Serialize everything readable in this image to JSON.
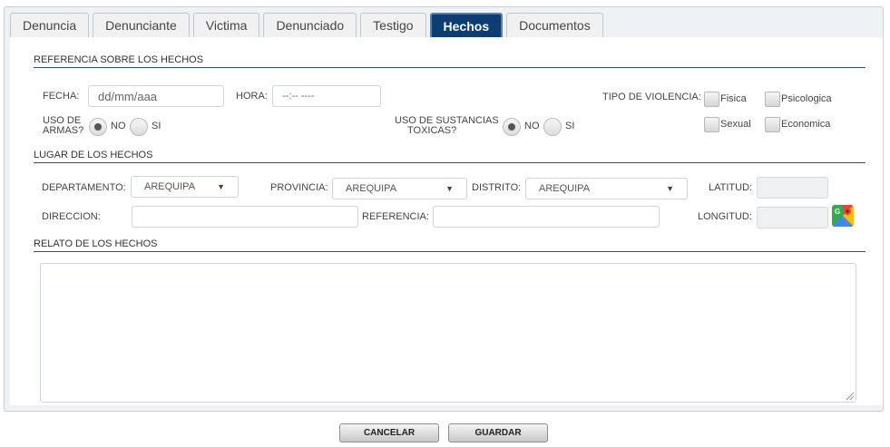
{
  "tabs": [
    {
      "label": "Denuncia"
    },
    {
      "label": "Denunciante"
    },
    {
      "label": "Victima"
    },
    {
      "label": "Denunciado"
    },
    {
      "label": "Testigo"
    },
    {
      "label": "Hechos",
      "active": true
    },
    {
      "label": "Documentos"
    }
  ],
  "referencia": {
    "title": "REFERENCIA SOBRE LOS HECHOS",
    "fecha_label": "FECHA:",
    "fecha_placeholder": "dd/mm/aaa",
    "hora_label": "HORA:",
    "hora_placeholder": "--:--  ----",
    "armas_label_1": "USO DE",
    "armas_label_2": "ARMAS?",
    "sustancias_label_1": "USO DE SUSTANCIAS",
    "sustancias_label_2": "TOXICAS?",
    "no_label": "NO",
    "si_label": "SI",
    "armas_value": "NO",
    "sustancias_value": "NO",
    "tipo_violencia_label": "TIPO DE VIOLENCIA:",
    "violencia_options": {
      "fisica": "Fisica",
      "psicologica": "Psicologica",
      "sexual": "Sexual",
      "economica": "Economica"
    }
  },
  "lugar": {
    "title": "LUGAR DE LOS HECHOS",
    "departamento_label": "DEPARTAMENTO:",
    "departamento_value": "AREQUIPA",
    "provincia_label": "PROVINCIA:",
    "provincia_value": "AREQUIPA",
    "distrito_label": "DISTRITO:",
    "distrito_value": "AREQUIPA",
    "latitud_label": "LATITUD:",
    "direccion_label": "DIRECCION:",
    "referencia_label": "REFERENCIA:",
    "longitud_label": "LONGITUD:"
  },
  "relato": {
    "title": "RELATO DE LOS HECHOS"
  },
  "actions": {
    "cancel_label": "CANCELAR",
    "save_label": "GUARDAR"
  },
  "colors": {
    "active_tab": "#0d3d73",
    "section_rule": "#2b4c7e"
  }
}
